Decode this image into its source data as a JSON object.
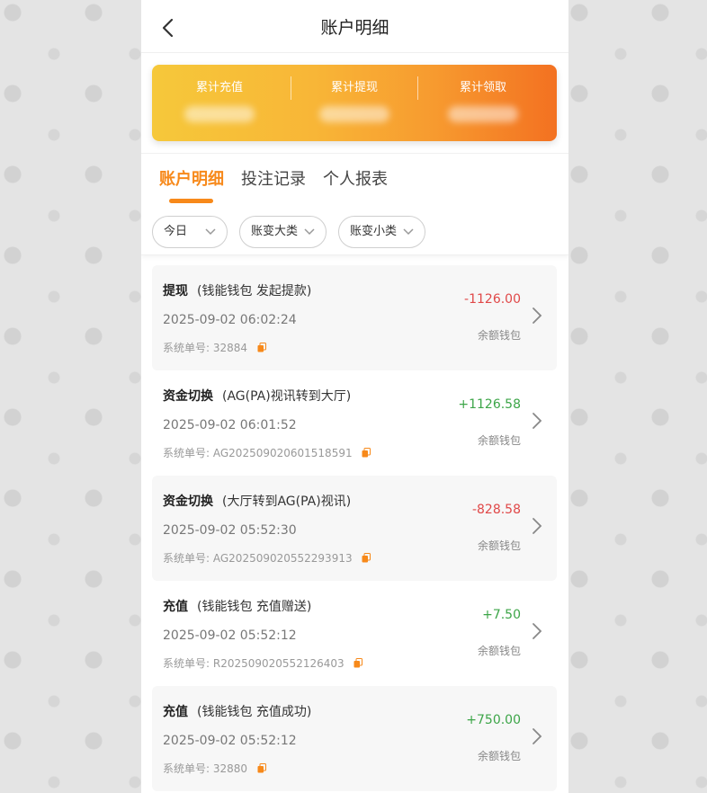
{
  "header": {
    "title": "账户明细"
  },
  "stats": [
    {
      "label": "累计充值"
    },
    {
      "label": "累计提现"
    },
    {
      "label": "累计领取"
    }
  ],
  "tabs": [
    {
      "label": "账户明细",
      "active": true
    },
    {
      "label": "投注记录",
      "active": false
    },
    {
      "label": "个人报表",
      "active": false
    }
  ],
  "filters": {
    "date": "今日",
    "major": "账变大类",
    "minor": "账变小类"
  },
  "sn_label": "系统单号:",
  "colors": {
    "accent": "#f7891a",
    "negative": "#e04848",
    "positive": "#3ca548"
  },
  "records": [
    {
      "type": "提现",
      "desc": "(钱能钱包 发起提款)",
      "time": "2025-09-02 06:02:24",
      "sn": "32884",
      "amount": "-1126.00",
      "sign": "neg",
      "wallet": "余额钱包"
    },
    {
      "type": "资金切换",
      "desc": "(AG(PA)视讯转到大厅)",
      "time": "2025-09-02 06:01:52",
      "sn": "AG202509020601518591",
      "amount": "+1126.58",
      "sign": "pos",
      "wallet": "余额钱包"
    },
    {
      "type": "资金切换",
      "desc": "(大厅转到AG(PA)视讯)",
      "time": "2025-09-02 05:52:30",
      "sn": "AG202509020552293913",
      "amount": "-828.58",
      "sign": "neg",
      "wallet": "余额钱包"
    },
    {
      "type": "充值",
      "desc": "(钱能钱包 充值赠送)",
      "time": "2025-09-02 05:52:12",
      "sn": "R202509020552126403",
      "amount": "+7.50",
      "sign": "pos",
      "wallet": "余额钱包"
    },
    {
      "type": "充值",
      "desc": "(钱能钱包 充值成功)",
      "time": "2025-09-02 05:52:12",
      "sn": "32880",
      "amount": "+750.00",
      "sign": "pos",
      "wallet": "余额钱包"
    }
  ]
}
